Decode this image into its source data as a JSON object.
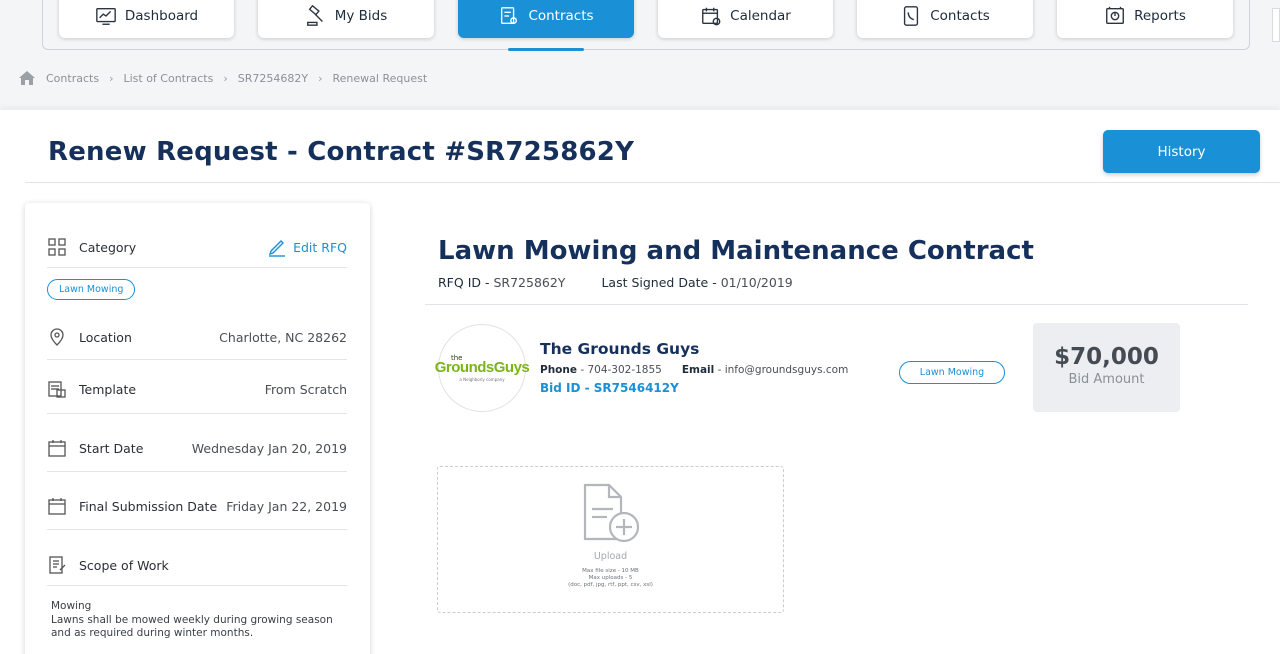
{
  "nav": {
    "items": [
      {
        "label": "Dashboard",
        "icon": "dashboard-icon"
      },
      {
        "label": "My Bids",
        "icon": "gavel-icon"
      },
      {
        "label": "Contracts",
        "icon": "contracts-icon",
        "active": true
      },
      {
        "label": "Calendar",
        "icon": "calendar-icon"
      },
      {
        "label": "Contacts",
        "icon": "phone-icon"
      },
      {
        "label": "Reports",
        "icon": "reports-icon"
      }
    ]
  },
  "breadcrumb": [
    "Contracts",
    "List of Contracts",
    "SR7254682Y",
    "Renewal Request"
  ],
  "page": {
    "title": "Renew Request - Contract #SR725862Y",
    "history_label": "History"
  },
  "side": {
    "category_label": "Category",
    "edit_label": "Edit RFQ",
    "category_tag": "Lawn Mowing",
    "location_label": "Location",
    "location_value": "Charlotte, NC 28262",
    "template_label": "Template",
    "template_value": "From Scratch",
    "start_label": "Start Date",
    "start_value": "Wednesday Jan 20, 2019",
    "final_label": "Final Submission Date",
    "final_value": "Friday Jan 22, 2019",
    "scope_label": "Scope of Work",
    "scope_title": "Mowing",
    "scope_text": "Lawns shall be mowed weekly during growing season and as required during winter months."
  },
  "contract": {
    "title": "Lawn Mowing and Maintenance Contract",
    "rfq_label": "RFQ ID",
    "rfq_value": "SR725862Y",
    "signed_label": "Last Signed Date",
    "signed_value": "01/10/2019"
  },
  "vendor": {
    "logo_the": "the",
    "logo_name": "GroundsGuys",
    "logo_sub": "a Neighborly company",
    "name": "The Grounds Guys",
    "phone_label": "Phone",
    "phone_value": "704-302-1855",
    "email_label": "Email",
    "email_value": "info@groundsguys.com",
    "bid_id": "Bid ID - SR7546412Y",
    "tag": "Lawn Mowing",
    "bid_amount": "$70,000",
    "bid_label": "Bid Amount"
  },
  "upload": {
    "label": "Upload",
    "note_1": "Max file size - 10 MB",
    "note_2": "Max uploads - 5",
    "note_3": "(doc, pdf, jpg, rtf, ppt, csv, xsl)"
  },
  "colors": {
    "accent": "#1a90d6",
    "heading": "#16305c"
  }
}
